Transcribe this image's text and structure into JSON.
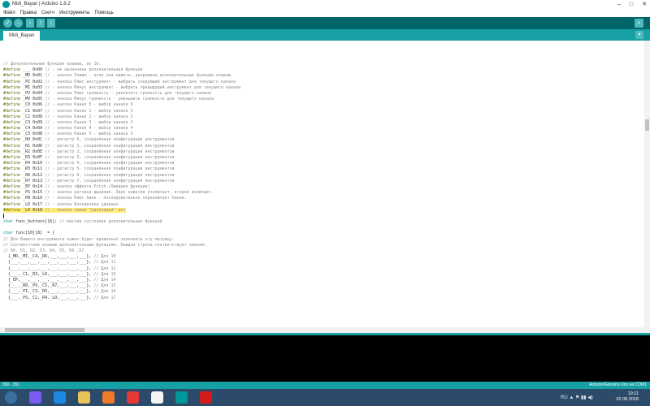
{
  "window": {
    "title": "Midi_Bayan | Arduino 1.8.2",
    "controls": [
      "–",
      "□",
      "✕"
    ]
  },
  "menu": [
    "Файл",
    "Правка",
    "Скетч",
    "Инструменты",
    "Помощь"
  ],
  "toolbar": {
    "buttons": [
      {
        "name": "verify",
        "glyph": "✓"
      },
      {
        "name": "upload",
        "glyph": "→"
      },
      {
        "name": "new",
        "glyph": "▫"
      },
      {
        "name": "open",
        "glyph": "↑"
      },
      {
        "name": "save",
        "glyph": "↓"
      }
    ],
    "serial_glyph": "⌕"
  },
  "tab": {
    "label": "Midi_Bayan",
    "menu_glyph": "▾"
  },
  "code_lines": [
    [
      {
        "t": "// Дополнительные функции клавиш, их 16:",
        "c": "cm"
      }
    ],
    [
      {
        "t": "#define",
        "c": "kw"
      },
      {
        "t": " ___ 0x00 "
      },
      {
        "t": "// - не назначена дополнительная функция",
        "c": "cm"
      }
    ],
    [
      {
        "t": "#define",
        "c": "kw"
      },
      {
        "t": " _MD 0x01 "
      },
      {
        "t": "// - кнопка Режим - если она нажата, разрешены дополнительные функции клавиш",
        "c": "cm"
      }
    ],
    [
      {
        "t": "#define",
        "c": "kw"
      },
      {
        "t": " _PI 0x02 "
      },
      {
        "t": "// - кнопка Плюс инструмент - выбрать следующий инструмент для текущего канала",
        "c": "cm"
      }
    ],
    [
      {
        "t": "#define",
        "c": "kw"
      },
      {
        "t": " _MI 0x03 "
      },
      {
        "t": "// - кнопка Минус инструмент - выбрать предыдущий инструмент для текущего канала",
        "c": "cm"
      }
    ],
    [
      {
        "t": "#define",
        "c": "kw"
      },
      {
        "t": " _PV 0x04 "
      },
      {
        "t": "// - кнопка Плюс громкость - увеличить громкость для текущего канала",
        "c": "cm"
      }
    ],
    [
      {
        "t": "#define",
        "c": "kw"
      },
      {
        "t": " _MV 0x05 "
      },
      {
        "t": "// - кнопка Минус громкость - уменьшить громкость для текущего канала",
        "c": "cm"
      }
    ],
    [
      {
        "t": "#define",
        "c": "kw"
      },
      {
        "t": " _C0 0x06 "
      },
      {
        "t": "// - кнопка Канал 0 - выбор канала 0",
        "c": "cm"
      }
    ],
    [
      {
        "t": "#define",
        "c": "kw"
      },
      {
        "t": " _C1 0x07 "
      },
      {
        "t": "// - кнопка Канал 1 - выбор канала 1",
        "c": "cm"
      }
    ],
    [
      {
        "t": "#define",
        "c": "kw"
      },
      {
        "t": " _C2 0x08 "
      },
      {
        "t": "// - кнопка Канал 2 - выбор канала 2",
        "c": "cm"
      }
    ],
    [
      {
        "t": "#define",
        "c": "kw"
      },
      {
        "t": " _C3 0x09 "
      },
      {
        "t": "// - кнопка Канал 3 - выбор канала 3",
        "c": "cm"
      }
    ],
    [
      {
        "t": "#define",
        "c": "kw"
      },
      {
        "t": " _C4 0x0A "
      },
      {
        "t": "// - кнопка Канал 4 - выбор канала 4",
        "c": "cm"
      }
    ],
    [
      {
        "t": "#define",
        "c": "kw"
      },
      {
        "t": " _C5 0x0B "
      },
      {
        "t": "// - кнопка Канал 5 - выбор канала 5",
        "c": "cm"
      }
    ],
    [
      {
        "t": "#define",
        "c": "kw"
      },
      {
        "t": " _R0 0x0C "
      },
      {
        "t": "// - регистр 0, сохранённая конфигурация инструментов",
        "c": "cm"
      }
    ],
    [
      {
        "t": "#define",
        "c": "kw"
      },
      {
        "t": " _R1 0x0D "
      },
      {
        "t": "// - регистр 1, сохранённая конфигурация инструментов",
        "c": "cm"
      }
    ],
    [
      {
        "t": "#define",
        "c": "kw"
      },
      {
        "t": " _R2 0x0E "
      },
      {
        "t": "// - регистр 2, сохранённая конфигурация инструментов",
        "c": "cm"
      }
    ],
    [
      {
        "t": "#define",
        "c": "kw"
      },
      {
        "t": " _R3 0x0F "
      },
      {
        "t": "// - регистр 3, сохранённая конфигурация инструментов",
        "c": "cm"
      }
    ],
    [
      {
        "t": "#define",
        "c": "kw"
      },
      {
        "t": " _R4 0x10 "
      },
      {
        "t": "// - регистр 4, сохранённая конфигурация инструментов",
        "c": "cm"
      }
    ],
    [
      {
        "t": "#define",
        "c": "kw"
      },
      {
        "t": " _R5 0x11 "
      },
      {
        "t": "// - регистр 5, сохранённая конфигурация инструментов",
        "c": "cm"
      }
    ],
    [
      {
        "t": "#define",
        "c": "kw"
      },
      {
        "t": " _R6 0x12 "
      },
      {
        "t": "// - регистр 6, сохранённая конфигурация инструментов",
        "c": "cm"
      }
    ],
    [
      {
        "t": "#define",
        "c": "kw"
      },
      {
        "t": " _R7 0x13 "
      },
      {
        "t": "// - регистр 7, сохранённая конфигурация инструментов",
        "c": "cm"
      }
    ],
    [
      {
        "t": "#define",
        "c": "kw"
      },
      {
        "t": " _EP 0x14 "
      },
      {
        "t": "// - кнопка эффекта Pitch (Ожившая функция)",
        "c": "cm"
      }
    ],
    [
      {
        "t": "#define",
        "c": "kw"
      },
      {
        "t": " _PS 0x15 "
      },
      {
        "t": "// - кнопка датчика дыхания. Одно нажатие отключает, второе включает.",
        "c": "cm"
      }
    ],
    [
      {
        "t": "#define",
        "c": "kw"
      },
      {
        "t": " _PB 0x16 "
      },
      {
        "t": "// - кнопка Плюс банк - последовательно переключает банки.",
        "c": "cm"
      }
    ],
    [
      {
        "t": "#define",
        "c": "kw"
      },
      {
        "t": " _LD 0x17 "
      },
      {
        "t": "// - кнопка Блокировка ударных",
        "c": "cm"
      }
    ],
    [
      {
        "t": "#define",
        "c": "kw hl"
      },
      {
        "t": " _LO 0x18 ",
        "c": "hl"
      },
      {
        "t": "// - кнопка смены \"раскладки\" нот",
        "c": "cm hl"
      }
    ],
    [
      {
        "t": "",
        "cursor": true
      }
    ],
    [
      {
        "t": "char",
        "c": "ty"
      },
      {
        "t": " func_buttons[16]; "
      },
      {
        "t": "// массив состояния дополнительных функций",
        "c": "cm"
      }
    ],
    [
      {
        "t": ""
      }
    ],
    [
      {
        "t": "char",
        "c": "ty"
      },
      {
        "t": " func[10][8]  = {"
      }
    ],
    [
      {
        "t": "// Для Вашего инструмента нужно будет правильно заполнить эту матрицу.",
        "c": "cm"
      }
    ],
    [
      {
        "t": "// Соответствие клавиш дополнительным функциям. Каждая строка соответствует линиям:",
        "c": "cm"
      }
    ],
    [
      {
        "t": "// D0, D1, D2, D3, D4, D5, D6 ,D7",
        "c": "cm"
      }
    ],
    [
      {
        "t": "  {_MD,_MI,_C4,_R6,___,___,___,___}, "
      },
      {
        "t": "// Для 10",
        "c": "cm"
      }
    ],
    [
      {
        "t": "  {___,___,___,___,___,___,___,___}, "
      },
      {
        "t": "// Для 11",
        "c": "cm"
      }
    ],
    [
      {
        "t": "  {___,___,___,___,___,___,___,___}, "
      },
      {
        "t": "// Для 12",
        "c": "cm"
      }
    ],
    [
      {
        "t": "  {___,_C1,_R3,_LD,___,___,___,___}, "
      },
      {
        "t": "// Для 13",
        "c": "cm"
      }
    ],
    [
      {
        "t": "  {_EP,___,___,___,___,___,___,___}, "
      },
      {
        "t": "// Для 14",
        "c": "cm"
      }
    ],
    [
      {
        "t": "  {___,_R0,_PV,_C5,_R7,___,___,___}, "
      },
      {
        "t": "// Для 15",
        "c": "cm"
      }
    ],
    [
      {
        "t": "  {___,_PI,_C3,_R5,___,___,___,___}, "
      },
      {
        "t": "// Для 16",
        "c": "cm"
      }
    ],
    [
      {
        "t": "  {___,_PS,_C2,_R4,_LD,___,___,___}, "
      },
      {
        "t": "// Для 17",
        "c": "cm"
      }
    ]
  ],
  "status": {
    "position": "350 - 351",
    "board": "Arduino/Genuino Uno на COM1"
  },
  "taskbar": {
    "apps": [
      {
        "name": "start-orb",
        "color": "#3b6fa0"
      },
      {
        "name": "alice",
        "color": "#7b5cf0"
      },
      {
        "name": "ie",
        "color": "#1e88e5"
      },
      {
        "name": "folder",
        "color": "#e8c35a"
      },
      {
        "name": "media",
        "color": "#f07a28"
      },
      {
        "name": "yandex",
        "color": "#e53935"
      },
      {
        "name": "yandex-browser",
        "color": "#f5f5f5"
      },
      {
        "name": "arduino",
        "color": "#00979c"
      },
      {
        "name": "opera",
        "color": "#d51a1a"
      }
    ],
    "tray": "RU ▲ ⚑ ▮▮ ◀)",
    "time": "19:11",
    "date": "02.08.2018"
  },
  "colors": {
    "teal_dark": "#006468",
    "teal": "#17a1a5",
    "keyword": "#5e6d03",
    "comment": "#8a8a8a",
    "type": "#00979c",
    "highlight": "#ffeb7a"
  }
}
